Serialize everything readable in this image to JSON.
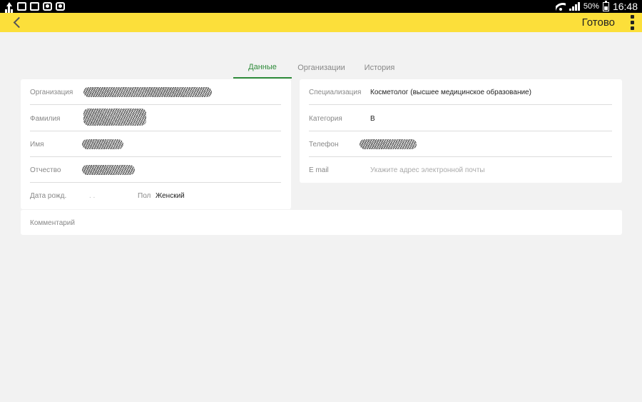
{
  "statusbar": {
    "battery": "50%",
    "time": "16:48"
  },
  "toolbar": {
    "done_label": "Готово"
  },
  "tabs": [
    {
      "label": "Данные",
      "active": true
    },
    {
      "label": "Организации",
      "active": false
    },
    {
      "label": "История",
      "active": false
    }
  ],
  "left_card": {
    "organization_label": "Организация",
    "surname_label": "Фамилия",
    "name_label": "Имя",
    "patronymic_label": "Отчество",
    "birthdate_label": "Дата рожд.",
    "birthdate_value": ". .",
    "gender_label": "Пол",
    "gender_value": "Женский"
  },
  "right_card": {
    "specialization_label": "Специализация",
    "specialization_value": "Косметолог (высшее медицинское образование)",
    "category_label": "Категория",
    "category_value": "В",
    "phone_label": "Телефон",
    "email_label": "E mail",
    "email_placeholder": "Укажите адрес электронной почты"
  },
  "comment": {
    "label": "Комментарий"
  },
  "colors": {
    "accent": "#fcdf3a",
    "active_tab": "#2e8b3a",
    "background": "#f2f2f2"
  }
}
